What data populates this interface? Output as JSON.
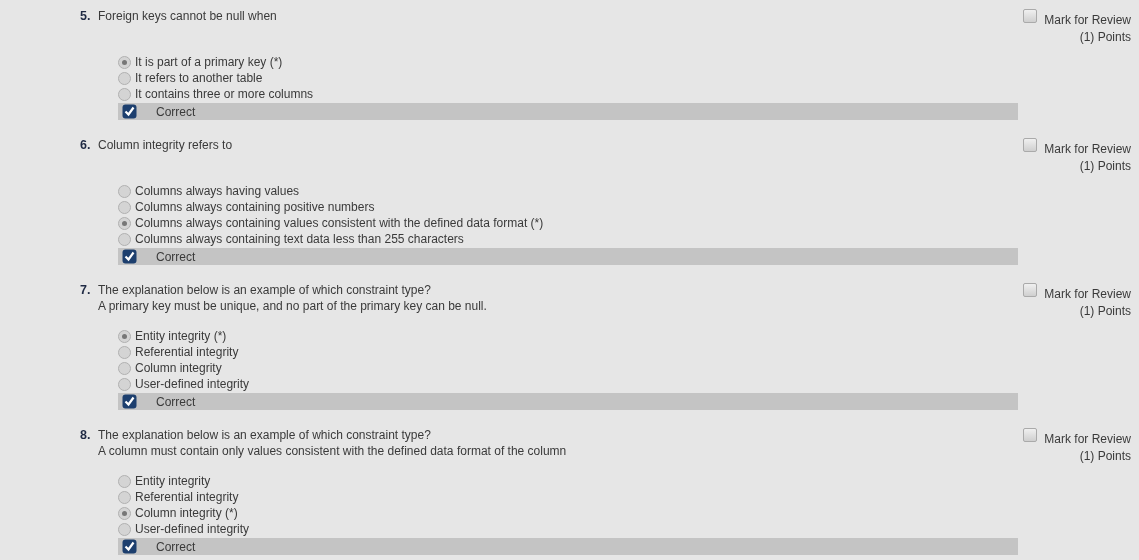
{
  "questions": [
    {
      "number": "5.",
      "text": "Foreign keys cannot be null when",
      "review": {
        "label": "Mark for Review",
        "checked": false
      },
      "points": "(1) Points",
      "options": [
        {
          "text": "It is part of a primary key (*)",
          "selected": true
        },
        {
          "text": "It refers to another table",
          "selected": false
        },
        {
          "text": "It contains three or more columns",
          "selected": false
        }
      ],
      "result": {
        "label": "Correct",
        "correct": true
      }
    },
    {
      "number": "6.",
      "text": "Column integrity refers to",
      "review": {
        "label": "Mark for Review",
        "checked": false
      },
      "points": "(1) Points",
      "options": [
        {
          "text": "Columns always having values",
          "selected": false
        },
        {
          "text": "Columns always containing positive numbers",
          "selected": false
        },
        {
          "text": "Columns always containing values consistent with the defined data format (*)",
          "selected": true
        },
        {
          "text": "Columns always containing text data less than 255 characters",
          "selected": false
        }
      ],
      "result": {
        "label": "Correct",
        "correct": true
      }
    },
    {
      "number": "7.",
      "text": "The explanation below is an example of which constraint type?",
      "subtext": "A primary key must be unique, and no part of the primary key can be null.",
      "review": {
        "label": "Mark for Review",
        "checked": false
      },
      "points": "(1) Points",
      "options": [
        {
          "text": "Entity integrity (*)",
          "selected": true
        },
        {
          "text": "Referential integrity",
          "selected": false
        },
        {
          "text": "Column integrity",
          "selected": false
        },
        {
          "text": "User-defined integrity",
          "selected": false
        }
      ],
      "result": {
        "label": "Correct",
        "correct": true
      }
    },
    {
      "number": "8.",
      "text": "The explanation below is an example of which constraint type?",
      "subtext": "A column must contain only values consistent with the defined data format of the column",
      "review": {
        "label": "Mark for Review",
        "checked": false
      },
      "points": "(1) Points",
      "options": [
        {
          "text": "Entity integrity",
          "selected": false
        },
        {
          "text": "Referential integrity",
          "selected": false
        },
        {
          "text": "Column integrity (*)",
          "selected": true
        },
        {
          "text": "User-defined integrity",
          "selected": false
        }
      ],
      "result": {
        "label": "Correct",
        "correct": true
      }
    }
  ]
}
